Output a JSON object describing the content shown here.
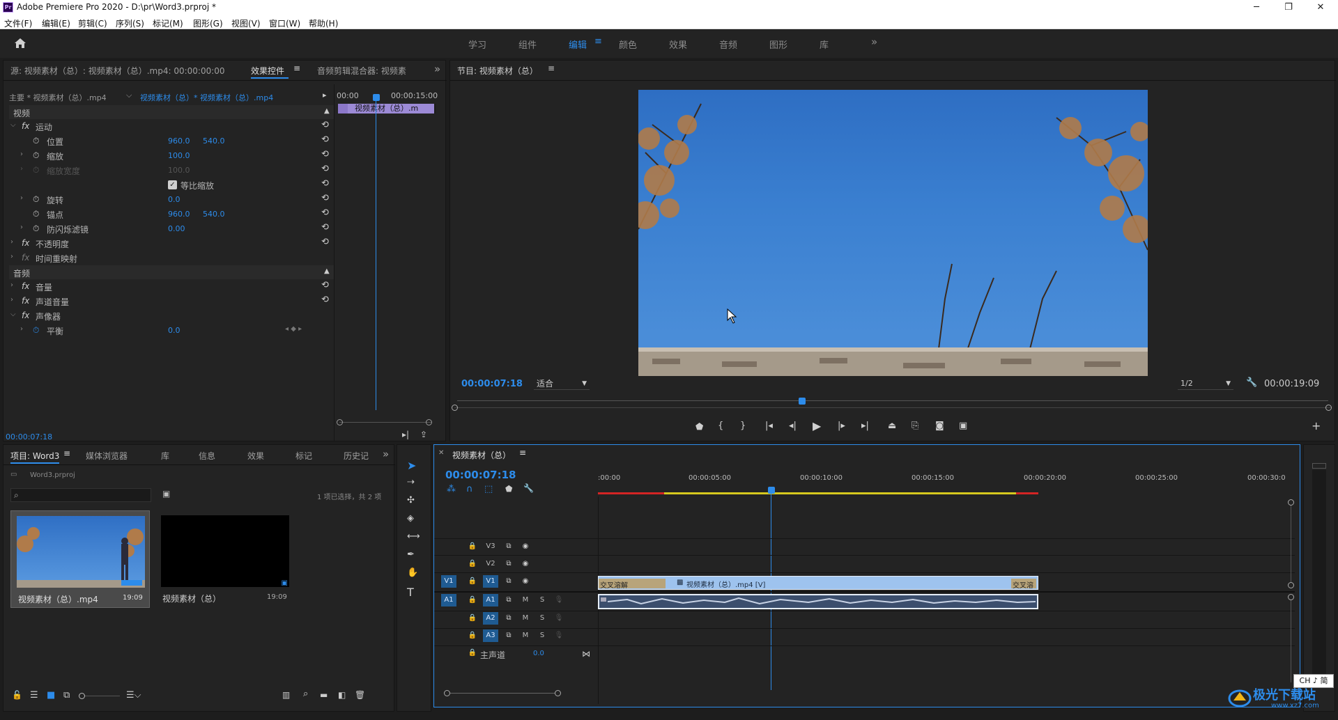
{
  "titlebar": {
    "logo": "Pr",
    "title": "Adobe Premiere Pro 2020 - D:\\pr\\Word3.prproj *"
  },
  "menubar": {
    "items": [
      "文件(F)",
      "编辑(E)",
      "剪辑(C)",
      "序列(S)",
      "标记(M)",
      "图形(G)",
      "视图(V)",
      "窗口(W)",
      "帮助(H)"
    ]
  },
  "workspaces": {
    "items": [
      "学习",
      "组件",
      "编辑",
      "颜色",
      "效果",
      "音频",
      "图形",
      "库"
    ],
    "active": "编辑"
  },
  "source_panel": {
    "tabs": [
      "源: 视频素材（总）: 视频素材（总）.mp4: 00:00:00:00",
      "效果控件",
      "音频剪辑混合器: 视频素"
    ],
    "master": "主要 * 视频素材（总）.mp4",
    "sequence": "视频素材（总）* 视频素材（总）.mp4",
    "ruler": [
      "00:00",
      "00:00:15:00"
    ],
    "clip": "视频素材（总）.m",
    "sections": {
      "video": "视频",
      "audio": "音频"
    },
    "properties": [
      {
        "name": "运动",
        "fx": true,
        "expanded": true
      },
      {
        "name": "位置",
        "v1": "960.0",
        "v2": "540.0"
      },
      {
        "name": "缩放",
        "v1": "100.0"
      },
      {
        "name": "缩放宽度",
        "v1": "100.0",
        "disabled": true
      },
      {
        "name": "等比缩放",
        "checkbox": true
      },
      {
        "name": "旋转",
        "v1": "0.0"
      },
      {
        "name": "锚点",
        "v1": "960.0",
        "v2": "540.0"
      },
      {
        "name": "防闪烁滤镜",
        "v1": "0.00"
      },
      {
        "name": "不透明度",
        "fx": true
      },
      {
        "name": "时间重映射",
        "fx": true
      }
    ],
    "audio_properties": [
      {
        "name": "音量",
        "fx": true
      },
      {
        "name": "声道音量",
        "fx": true
      },
      {
        "name": "声像器",
        "fx": true,
        "expanded": true
      },
      {
        "name": "平衡",
        "v1": "0.0"
      }
    ],
    "timecode": "00:00:07:18"
  },
  "program": {
    "title": "节目: 视频素材（总）",
    "timecode": "00:00:07:18",
    "fit": "适合",
    "resolution": "1/2",
    "duration": "00:00:19:09"
  },
  "project": {
    "tabs": [
      "项目: Word3",
      "媒体浏览器",
      "库",
      "信息",
      "效果",
      "标记",
      "历史记"
    ],
    "file": "Word3.prproj",
    "selection": "1 项已选择，共 2 项",
    "items": [
      {
        "name": "视频素材（总）.mp4",
        "duration": "19:09"
      },
      {
        "name": "视频素材（总）",
        "duration": "19:09"
      }
    ]
  },
  "timeline": {
    "title": "视频素材（总）",
    "timecode": "00:00:07:18",
    "ruler": [
      ":00:00",
      "00:00:05:00",
      "00:00:10:00",
      "00:00:15:00",
      "00:00:20:00",
      "00:00:25:00",
      "00:00:30:0"
    ],
    "tracks": {
      "video": [
        "V3",
        "V2",
        "V1"
      ],
      "audio": [
        "A1",
        "A2",
        "A3"
      ],
      "master": "主声道",
      "master_value": "0.0",
      "source_v": "V1",
      "source_a": "A1"
    },
    "mute": "M",
    "solo": "S",
    "clips": {
      "v1_transition_a": "交叉溶解",
      "v1_main": "视频素材（总）.mp4 [V]",
      "v1_transition_b": "交叉溶"
    }
  },
  "ime": "CH ♪ 简",
  "watermark": "极光下载站",
  "watermark_url": "www.xz7.com"
}
